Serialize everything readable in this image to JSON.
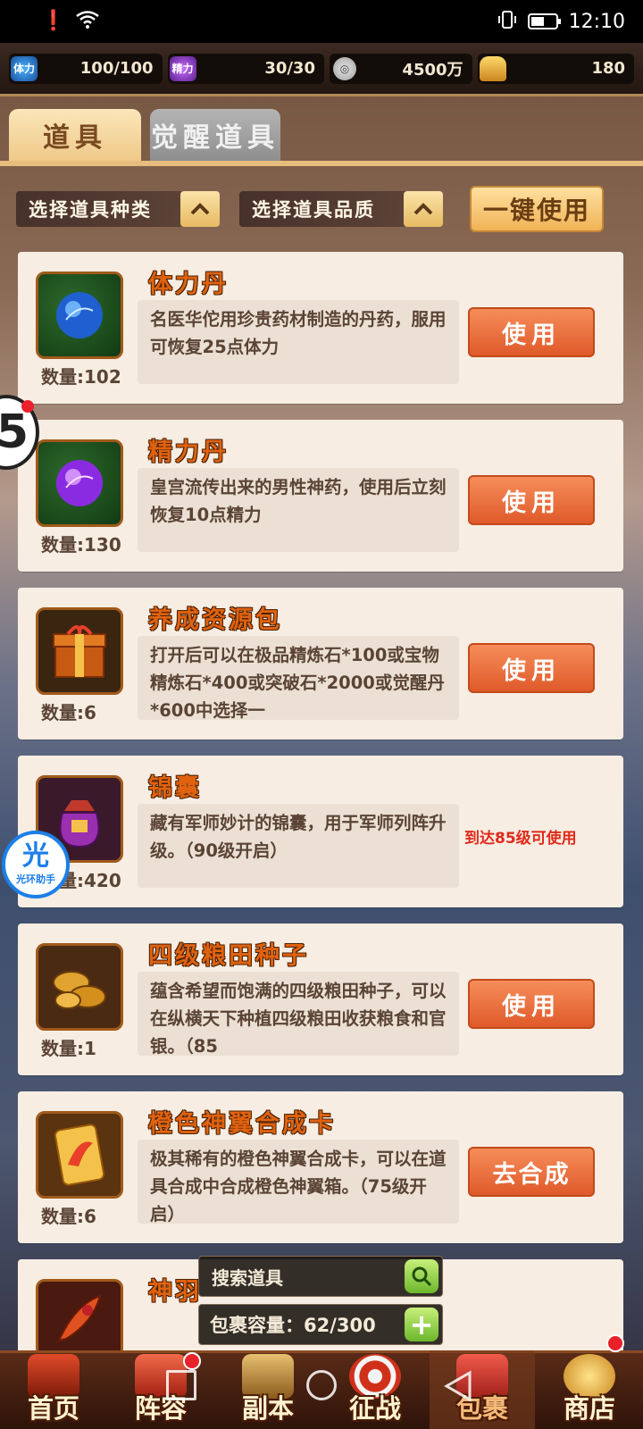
{
  "status_bar": {
    "time": "12:10"
  },
  "resources": [
    {
      "icon": "stamina-icon",
      "label": "体力",
      "value": "100/100"
    },
    {
      "icon": "energy-icon",
      "label": "精力",
      "value": "30/30"
    },
    {
      "icon": "silver-coin-icon",
      "label": "",
      "value": "4500万"
    },
    {
      "icon": "gold-ingot-icon",
      "label": "",
      "value": "180"
    }
  ],
  "tabs": {
    "items": "道具",
    "awaken_items": "觉醒道具"
  },
  "filters": {
    "type_label": "选择道具种类",
    "quality_label": "选择道具品质",
    "one_key_use": "一键使用",
    "chevron": "^"
  },
  "items": [
    {
      "name": "体力丹",
      "desc": "名医华佗用珍贵药材制造的丹药，服用可恢复25点体力",
      "qty": "数量:102",
      "action": "使用",
      "icon": "blue-orb-icon"
    },
    {
      "name": "精力丹",
      "desc": "皇宫流传出来的男性神药，使用后立刻恢复10点精力",
      "qty": "数量:130",
      "action": "使用",
      "icon": "purple-orb-icon"
    },
    {
      "name": "养成资源包",
      "desc": "打开后可以在极品精炼石*100或宝物精炼石*400或突破石*2000或觉醒丹*600中选择一",
      "qty": "数量:6",
      "action": "使用",
      "icon": "treasure-chest-icon"
    },
    {
      "name": "锦囊",
      "desc": "藏有军师妙计的锦囊，用于军师列阵升级。（90级开启）",
      "qty": "数量:420",
      "action": "",
      "note": "到达85级可使用",
      "icon": "pouch-icon"
    },
    {
      "name": "四级粮田种子",
      "desc": "蕴含希望而饱满的四级粮田种子，可以在纵横天下种植四级粮田收获粮食和官银。（85",
      "qty": "数量:1",
      "action": "使用",
      "icon": "seeds-icon"
    },
    {
      "name": "橙色神翼合成卡",
      "desc": "极其稀有的橙色神翼合成卡，可以在道具合成中合成橙色神翼箱。（75级开启）",
      "qty": "数量:6",
      "action": "去合成",
      "icon": "wing-card-icon"
    },
    {
      "name": "神羽",
      "desc": "",
      "qty": "",
      "action": "",
      "icon": "feather-icon"
    }
  ],
  "bottom_panel": {
    "search_label": "搜索道具",
    "capacity_label": "包裹容量：62/300"
  },
  "nav": [
    {
      "label": "首页",
      "icon": "palace-icon"
    },
    {
      "label": "阵容",
      "icon": "flag-icon"
    },
    {
      "label": "副本",
      "icon": "crossed-swords-icon"
    },
    {
      "label": "征战",
      "icon": "target-icon"
    },
    {
      "label": "包裹",
      "icon": "bag-icon"
    },
    {
      "label": "商店",
      "icon": "coins-icon"
    }
  ],
  "overlays": {
    "floating_badge": "5",
    "assistant_glyph": "光",
    "assistant_label": "光环助手"
  },
  "colors": {
    "accent_orange": "#e0620f",
    "use_button": "#e05a2a",
    "locked_red": "#e0291a",
    "panel_cream": "#f7ede2"
  }
}
